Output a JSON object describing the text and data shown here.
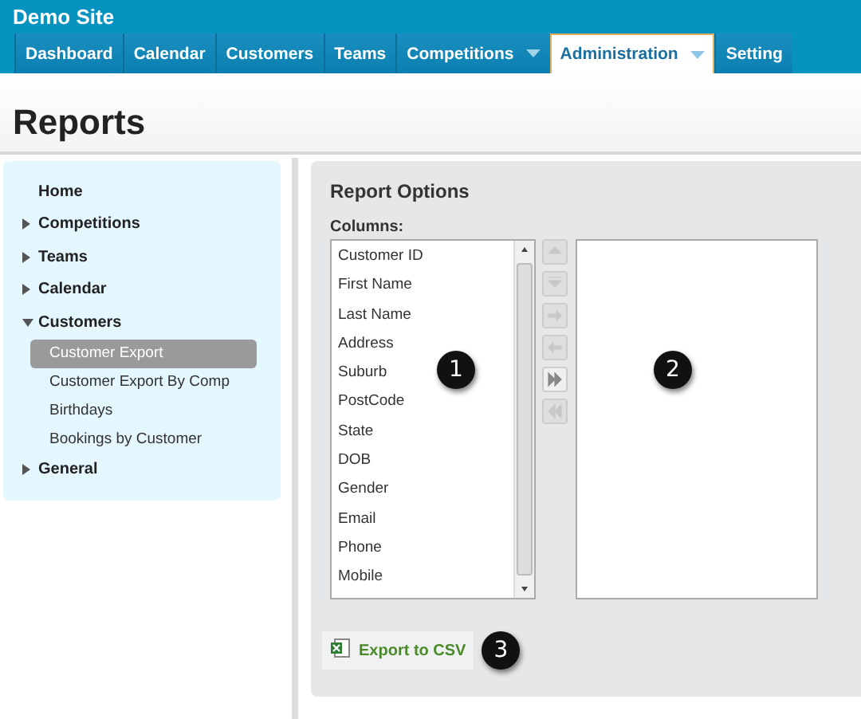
{
  "site": {
    "title": "Demo Site"
  },
  "nav_tabs": [
    {
      "label": "Dashboard",
      "selected": false,
      "dropdown": false
    },
    {
      "label": "Calendar",
      "selected": false,
      "dropdown": false
    },
    {
      "label": "Customers",
      "selected": false,
      "dropdown": false
    },
    {
      "label": "Teams",
      "selected": false,
      "dropdown": false
    },
    {
      "label": "Competitions",
      "selected": false,
      "dropdown": true
    },
    {
      "label": "Administration",
      "selected": true,
      "dropdown": true
    },
    {
      "label": "Setting",
      "selected": false,
      "dropdown": false
    }
  ],
  "page_title": "Reports",
  "sidebar": {
    "items": [
      {
        "label": "Home"
      },
      {
        "label": "Competitions",
        "expanded": false
      },
      {
        "label": "Teams",
        "expanded": false
      },
      {
        "label": "Calendar",
        "expanded": false
      },
      {
        "label": "Customers",
        "expanded": true,
        "children": [
          {
            "label": "Customer Export",
            "selected": true
          },
          {
            "label": "Customer Export By Comp",
            "selected": false
          },
          {
            "label": "Birthdays",
            "selected": false
          },
          {
            "label": "Bookings by Customer",
            "selected": false
          }
        ]
      },
      {
        "label": "General",
        "expanded": false
      }
    ]
  },
  "report_options": {
    "title": "Report Options",
    "columns_label": "Columns:",
    "available_columns": [
      "Customer ID",
      "First Name",
      "Last Name",
      "Address",
      "Suburb",
      "PostCode",
      "State",
      "DOB",
      "Gender",
      "Email",
      "Phone",
      "Mobile"
    ],
    "move_buttons": [
      {
        "kind": "up",
        "disabled": true
      },
      {
        "kind": "down",
        "disabled": true
      },
      {
        "kind": "right",
        "disabled": true
      },
      {
        "kind": "left",
        "disabled": true
      },
      {
        "kind": "all-right",
        "disabled": false
      },
      {
        "kind": "all-left",
        "disabled": true
      }
    ],
    "export_button": "Export to CSV"
  },
  "callouts": [
    "1",
    "2",
    "3"
  ]
}
